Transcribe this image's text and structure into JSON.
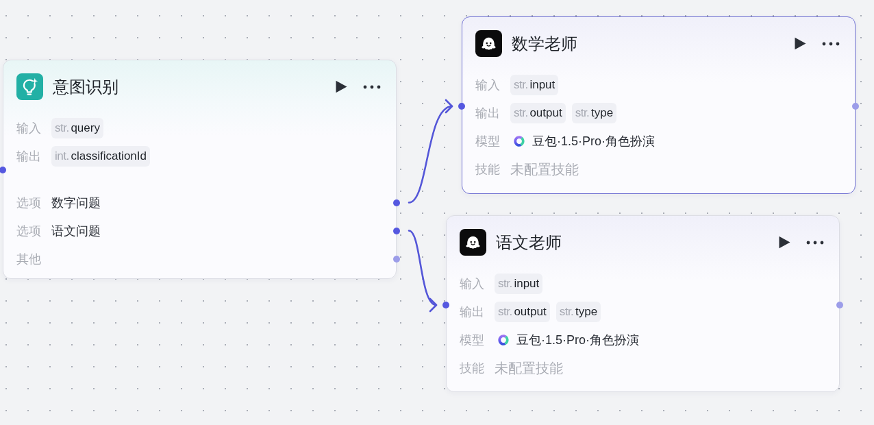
{
  "canvas": {
    "nodes": [
      {
        "kind": "classifier",
        "title": "意图识别",
        "selected": false,
        "input_port": {
          "connected": true
        },
        "rows": [
          {
            "kind": "params",
            "label": "输入",
            "params": [
              {
                "type": "str.",
                "name": "query"
              }
            ]
          },
          {
            "kind": "params",
            "label": "输出",
            "params": [
              {
                "type": "int.",
                "name": "classificationId"
              }
            ]
          }
        ],
        "options": [
          {
            "label": "选项",
            "value": "数字问题",
            "connected": true
          },
          {
            "label": "选项",
            "value": "语文问题",
            "connected": true
          },
          {
            "label": "其他",
            "connected": false
          }
        ]
      },
      {
        "kind": "agent",
        "title": "数学老师",
        "selected": true,
        "input_port": {
          "connected": true
        },
        "output_port": {
          "connected": false
        },
        "rows": [
          {
            "kind": "params",
            "label": "输入",
            "params": [
              {
                "type": "str.",
                "name": "input"
              }
            ]
          },
          {
            "kind": "params",
            "label": "输出",
            "params": [
              {
                "type": "str.",
                "name": "output"
              },
              {
                "type": "str.",
                "name": "type"
              }
            ]
          },
          {
            "kind": "model",
            "label": "模型",
            "value": "豆包·1.5·Pro·角色扮演"
          },
          {
            "kind": "note",
            "label": "技能",
            "value": "未配置技能"
          }
        ]
      },
      {
        "kind": "agent",
        "title": "语文老师",
        "selected": false,
        "input_port": {
          "connected": true
        },
        "output_port": {
          "connected": false
        },
        "rows": [
          {
            "kind": "params",
            "label": "输入",
            "params": [
              {
                "type": "str.",
                "name": "input"
              }
            ]
          },
          {
            "kind": "params",
            "label": "输出",
            "params": [
              {
                "type": "str.",
                "name": "output"
              },
              {
                "type": "str.",
                "name": "type"
              }
            ]
          },
          {
            "kind": "model",
            "label": "模型",
            "value": "豆包·1.5·Pro·角色扮演"
          },
          {
            "kind": "note",
            "label": "技能",
            "value": "未配置技能"
          }
        ]
      }
    ]
  }
}
